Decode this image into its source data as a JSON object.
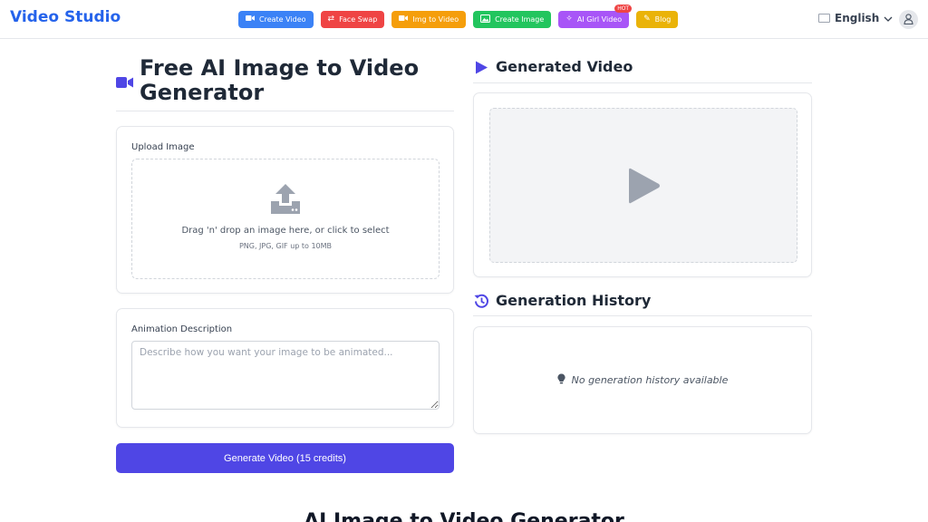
{
  "header": {
    "brand": "Video Studio",
    "nav": [
      {
        "label": "Create Video",
        "icon": "video-camera-icon",
        "color": "#3b82f6"
      },
      {
        "label": "Face Swap",
        "icon": "swap-arrows-icon",
        "color": "#ef4444"
      },
      {
        "label": "Img to Video",
        "icon": "video-camera-icon",
        "color": "#f59e0b"
      },
      {
        "label": "Create Image",
        "icon": "image-icon",
        "color": "#22c55e"
      },
      {
        "label": "AI Girl Video",
        "icon": "sparkle-wand-icon",
        "color": "#a855f7",
        "badge": "HOT"
      },
      {
        "label": "Blog",
        "icon": "blog-icon",
        "color": "#eab308"
      }
    ],
    "language": "English"
  },
  "left": {
    "title": "Free AI Image to Video Generator",
    "upload": {
      "label": "Upload Image",
      "drop_text": "Drag 'n' drop an image here, or click to select",
      "hint": "PNG, JPG, GIF up to 10MB"
    },
    "description": {
      "label": "Animation Description",
      "placeholder": "Describe how you want your image to be animated...",
      "value": ""
    },
    "generate_button": "Generate Video (15 credits)"
  },
  "right": {
    "generated_title": "Generated Video",
    "history_title": "Generation History",
    "history_empty": "No generation history available"
  },
  "bottom": {
    "heading": "AI Image to Video Generator"
  },
  "colors": {
    "brand": "#2563eb",
    "accent": "#4f46e5"
  }
}
